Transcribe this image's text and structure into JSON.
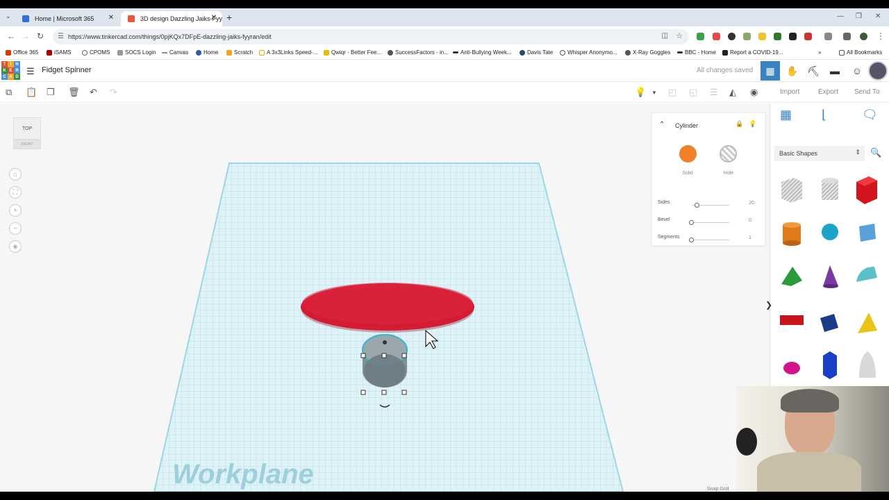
{
  "browser": {
    "tabs": [
      {
        "title": "Home | Microsoft 365",
        "active": false
      },
      {
        "title": "3D design Dazzling Jaiks-Fyyra",
        "active": true
      }
    ],
    "url": "https://www.tinkercad.com/things/0pjKQx7DFpE-dazzling-jaiks-fyyran/edit",
    "bookmarks": [
      "Office 365",
      "iSAMS",
      "CPOMS",
      "SOCS Login",
      "Canvas",
      "Home",
      "Scratch",
      "A 3x3Links Speed-...",
      "Qwiqr - Better Fee...",
      "SuccessFactors - in...",
      "Anti-Bullying Week...",
      "Davis Tate",
      "Whisper Anonymo...",
      "X-Ray Goggles",
      "BBC - Home",
      "Report a COVID-19..."
    ],
    "all_bookmarks": "All Bookmarks"
  },
  "app": {
    "logo_letters": [
      "TIN",
      "KER",
      "CAD"
    ],
    "design_title": "Fidget Spinner",
    "save_status": "All changes saved",
    "toolbar": {
      "import": "Import",
      "export": "Export",
      "send_to": "Send To"
    }
  },
  "workspace": {
    "viewcube_top": "TOP",
    "viewcube_front": "FRONT",
    "workplane_label": "Workplane",
    "snap_grid": "Snap Grid"
  },
  "inspector": {
    "shape_name": "Cylinder",
    "solid_label": "Solid",
    "hole_label": "Hole",
    "solid_color": "#f0802a",
    "props": [
      {
        "label": "Sides",
        "value": "20",
        "level": 0.0
      },
      {
        "label": "Bevel",
        "value": "0",
        "level": 0.0
      },
      {
        "label": "Segments",
        "value": "1",
        "level": 0.0
      }
    ]
  },
  "shapes_panel": {
    "category": "Basic Shapes",
    "shapes": [
      "box-hole",
      "cylinder-hole",
      "box",
      "cylinder",
      "sphere",
      "scribble",
      "roof",
      "cone",
      "round-roof",
      "text",
      "cube-blue",
      "hexagonal-prism",
      "pyramid",
      "half-sphere",
      "polygon",
      "paraboloid"
    ]
  }
}
